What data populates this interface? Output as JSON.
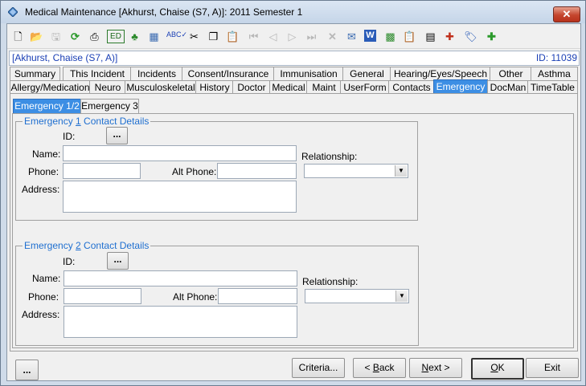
{
  "window": {
    "title": "Medical Maintenance   [Akhurst, Chaise (S7, A)]: 2011 Semester 1",
    "close_label": "✕"
  },
  "toolbar": {
    "icons": [
      "new-icon",
      "open-icon",
      "save-icon",
      "refresh-icon",
      "print-icon",
      "edit-icon",
      "tree-icon",
      "calculator-icon",
      "spellcheck-icon",
      "cut-icon",
      "copy-icon",
      "paste-icon",
      "first-record-icon",
      "previous-record-icon",
      "next-record-icon",
      "last-record-icon",
      "delete-icon",
      "email-icon",
      "word-icon",
      "excel-icon",
      "clipboard-icon",
      "calendar-icon",
      "medical-icon",
      "tag-icon",
      "add-icon"
    ]
  },
  "student": {
    "name": "[Akhurst, Chaise (S7, A)]",
    "id_text": "ID: 11039"
  },
  "tabs_row1": [
    "Summary",
    "This Incident",
    "Incidents",
    "Consent/Insurance",
    "Immunisation",
    "General",
    "Hearing/Eyes/Speech",
    "Other",
    "Asthma"
  ],
  "tabs_row2": [
    "Allergy/Medication",
    "Neuro",
    "Musculoskeletal",
    "History",
    "Doctor",
    "Medical",
    "Maint",
    "UserForm",
    "Contacts",
    "Emergency",
    "DocMan",
    "TimeTable"
  ],
  "active_tab": "Emergency",
  "subtabs": [
    "Emergency 1/2",
    "Emergency 3"
  ],
  "group1": {
    "title_pre": "Emergency ",
    "title_num": "1",
    "title_post": " Contact Details",
    "id_label": "ID:",
    "lookup_label": "...",
    "name_label": "Name:",
    "name_value": "",
    "phone_label": "Phone:",
    "phone_value": "",
    "alt_phone_label": "Alt Phone:",
    "alt_phone_value": "",
    "address_label": "Address:",
    "address_value": "",
    "relationship_label": "Relationship:",
    "relationship_value": ""
  },
  "group2": {
    "title_pre": "Emergency ",
    "title_num": "2",
    "title_post": " Contact Details",
    "id_label": "ID:",
    "lookup_label": "...",
    "name_label": "Name:",
    "name_value": "",
    "phone_label": "Phone:",
    "phone_value": "",
    "alt_phone_label": "Alt Phone:",
    "alt_phone_value": "",
    "address_label": "Address:",
    "address_value": "",
    "relationship_label": "Relationship:",
    "relationship_value": ""
  },
  "footer": {
    "more_label": "...",
    "criteria_pre": "Criteria...",
    "back_pre": "< ",
    "back_u": "B",
    "back_post": "ack",
    "next_pre": "",
    "next_u": "N",
    "next_post": "ext >",
    "ok_u": "O",
    "ok_post": "K",
    "exit_label": "Exit"
  }
}
